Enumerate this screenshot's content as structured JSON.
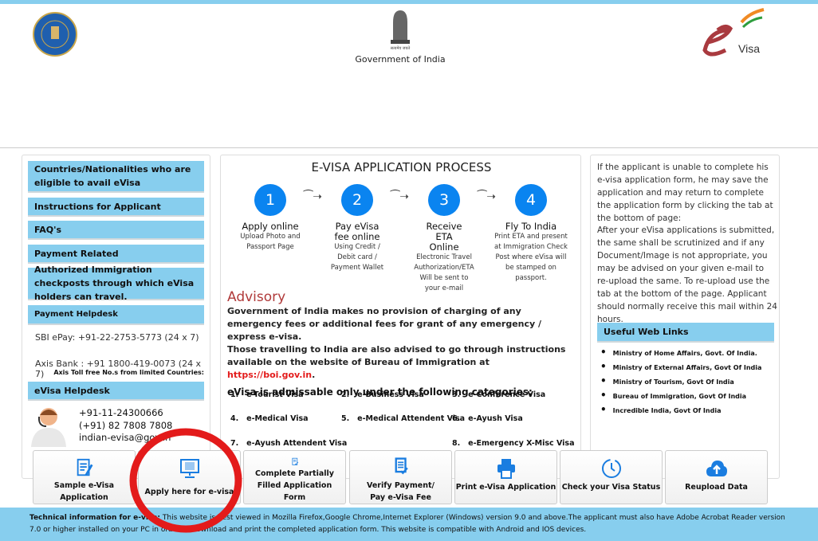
{
  "header": {
    "gov_text": "Government of India",
    "emblem_motto": "सत्यमेव जयते",
    "evisa_logo": "eVisa"
  },
  "left": {
    "menu": [
      "Countries/Nationalities who are eligible to avail eVisa",
      "Instructions for Applicant",
      "FAQ's",
      "Payment Related",
      "Authorized Immigration checkposts through which eVisa holders can travel.",
      "Payment Helpdesk"
    ],
    "sbi": "SBI ePay: +91-22-2753-5773 (24 x 7)",
    "axis": "Axis Bank : +91 1800-419-0073 (24 x 7)",
    "axis_note": "Axis Toll free No.s from limited Countries:",
    "evisa_helpdesk": "eVisa Helpdesk",
    "phone1": "+91-11-24300666",
    "phone2": "(+91) 82 7808 7808",
    "email": "indian-evisa@gov.in"
  },
  "center": {
    "title": "E-VISA APPLICATION PROCESS",
    "steps": [
      {
        "n": "1",
        "title": "Apply online",
        "desc": "Upload Photo and Passport Page"
      },
      {
        "n": "2",
        "title": "Pay eVisa fee online",
        "desc": "Using Credit / Debit card / Payment Wallet"
      },
      {
        "n": "3",
        "title": "Receive ETA Online",
        "desc": "Electronic Travel Authorization/ETA Will be sent to your e-mail"
      },
      {
        "n": "4",
        "title": "Fly To India",
        "desc": "Print ETA and present at Immigration Check Post where eVisa will be stamped on passport."
      }
    ],
    "advisory_title": "Advisory",
    "advisory1": "Government of India makes no provision of charging of any emergency fees or additional fees for grant of any emergency / express e-visa.",
    "advisory2": "Those travelling to India are also advised to go through instructions available on the website of Bureau of Immigration at ",
    "advisory_link": "https://boi.gov.in",
    "advisory_end": ".",
    "categories_heading": "eVisa is admissable only under the following categories:",
    "categories": [
      "1.   e-Tourist Visa",
      "2.   e-Business Visa",
      "3.   e-Conference Visa",
      "4.   e-Medical Visa",
      "5.   e-Medical Attendent Visa",
      "6.   e-Ayush Visa",
      "7.   e-Ayush Attendent Visa",
      "8.   e-Emergency X-Misc Visa"
    ]
  },
  "right": {
    "para1": "If the applicant is unable to complete his e-visa application form, he may save the application and may return to complete the application form by clicking the tab at the bottom of page:",
    "para2": "After your eVisa applications is submitted, the same shall be scrutinized and if any Document/Image is not appropriate, you may be advised on your given e-mail to re-upload the same. To re-upload use the tab at the bottom of the page. Applicant should normally receive this mail within 24 hours.",
    "links_title": "Useful Web Links",
    "links": [
      "Ministry of Home Affairs, Govt. Of India.",
      "Ministry of External Affairs, Govt Of India",
      "Ministry of Tourism, Govt Of India",
      "Bureau of Immigration, Govt Of India",
      "Incredible India, Govt Of India"
    ]
  },
  "buttons": [
    {
      "label": "Sample e-Visa Application",
      "icon": "document-edit-icon"
    },
    {
      "label": "Apply here for e-visa",
      "icon": "monitor-form-icon"
    },
    {
      "label": "Complete Partially Filled Application Form",
      "icon": "checklist-icon"
    },
    {
      "label": "Verify Payment/ Pay e-Visa Fee",
      "icon": "verify-document-icon"
    },
    {
      "label": "Print e-Visa Application",
      "icon": "printer-icon"
    },
    {
      "label": "Check your Visa Status",
      "icon": "clock-icon"
    },
    {
      "label": "Reupload Data",
      "icon": "cloud-upload-icon"
    }
  ],
  "footer": {
    "label": "Technical information for e-visa:",
    "text": " This website is best viewed in Mozilla Firefox,Google Chrome,Internet Explorer (Windows) version 9.0 and above.The applicant must also have Adobe Acrobat Reader version 7.0 or higher installed on your PC in order to download and print the completed application form. This website is compatible with Android and IOS devices."
  },
  "colors": {
    "accent": "#87ceee",
    "step_blue": "#0a84f0",
    "advisory_red": "#b03a3a",
    "annotation": "#e31b1b"
  }
}
